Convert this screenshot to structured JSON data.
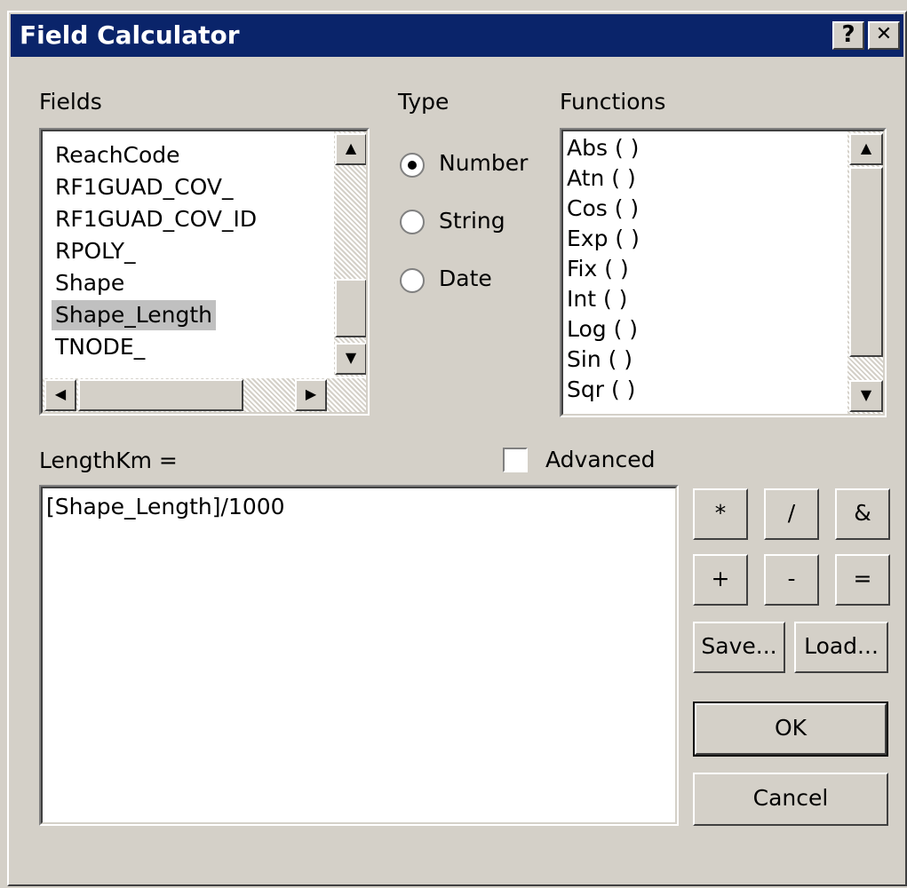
{
  "window": {
    "title": "Field Calculator",
    "help_label": "?",
    "close_label": "✕"
  },
  "fields": {
    "label": "Fields",
    "items": [
      "ReachCode",
      "RF1GUAD_COV_",
      "RF1GUAD_COV_ID",
      "RPOLY_",
      "Shape",
      "Shape_Length",
      "TNODE_"
    ],
    "selected": "Shape_Length"
  },
  "type": {
    "label": "Type",
    "options": [
      "Number",
      "String",
      "Date"
    ],
    "selected": "Number"
  },
  "functions": {
    "label": "Functions",
    "items": [
      "Abs ( )",
      "Atn ( )",
      "Cos ( )",
      "Exp ( )",
      "Fix ( )",
      "Int ( )",
      "Log ( )",
      "Sin ( )",
      "Sqr ( )"
    ]
  },
  "expression": {
    "label": "LengthKm =",
    "value": "[Shape_Length]/1000",
    "advanced_label": "Advanced",
    "advanced_checked": false
  },
  "operators": [
    "*",
    "/",
    "&",
    "+",
    "-",
    "="
  ],
  "buttons": {
    "save": "Save...",
    "load": "Load...",
    "ok": "OK",
    "cancel": "Cancel"
  },
  "icons": {
    "scroll_up": "▲",
    "scroll_down": "▼",
    "scroll_left": "◀",
    "scroll_right": "▶"
  }
}
